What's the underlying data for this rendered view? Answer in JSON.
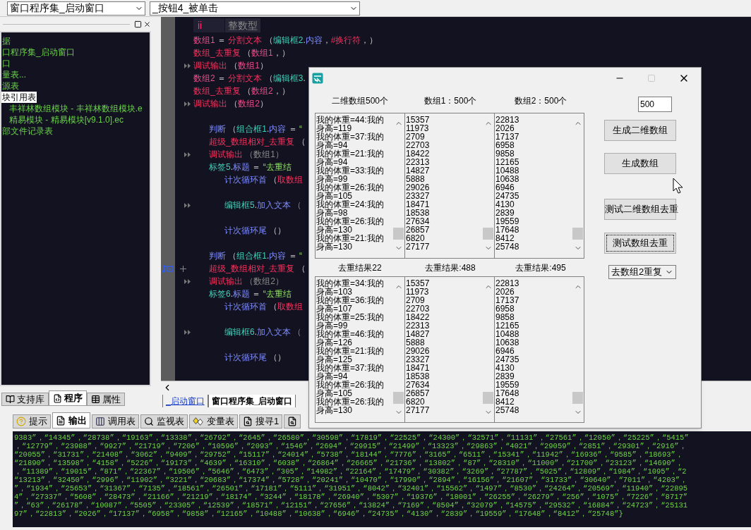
{
  "toolbar": {
    "combos": [
      {
        "value": "窗口程序集_启动窗口"
      },
      {
        "value": "_按钮4_被单击"
      }
    ]
  },
  "left_panel": {
    "tree": [
      {
        "label": "据",
        "selected": false
      },
      {
        "label": "口程序集_启动窗口",
        "selected": false
      },
      {
        "label": "口",
        "selected": false
      },
      {
        "label": "量表...",
        "selected": false
      },
      {
        "label": "源表",
        "selected": false
      },
      {
        "label": "块引用表",
        "selected": true,
        "children": [
          {
            "label": "丰祥林数组模块 - 丰祥林数组模块.e",
            "selected": false
          },
          {
            "label": "精易模块 - 精易模块[v9.1.0].ec",
            "selected": false
          }
        ]
      },
      {
        "label": "部文件记录表",
        "selected": false
      }
    ],
    "tabs": [
      {
        "label": "支持库",
        "selected": false
      },
      {
        "label": "程序",
        "selected": true
      },
      {
        "label": "属性",
        "selected": false
      }
    ]
  },
  "editor": {
    "variable_row": [
      "ii",
      "整数型"
    ],
    "lines": [
      {
        "kind": "code",
        "marked": false,
        "current": false,
        "tokens": [
          {
            "text": "数组1",
            "kind": "var"
          },
          {
            "text": " ＝ ",
            "kind": "op"
          },
          {
            "text": "分割文本",
            "kind": "func"
          },
          {
            "text": " （",
            "kind": "punct"
          },
          {
            "text": "编辑框2",
            "kind": "obj"
          },
          {
            "text": ".",
            "kind": "punct"
          },
          {
            "text": "内容",
            "kind": "ctrl"
          },
          {
            "text": "，",
            "kind": "punct"
          },
          {
            "text": "#换行符",
            "kind": "func"
          },
          {
            "text": "，）",
            "kind": "punct"
          }
        ]
      },
      {
        "kind": "code",
        "marked": false,
        "current": false,
        "tokens": [
          {
            "text": "数组_去重复",
            "kind": "func"
          },
          {
            "text": " （",
            "kind": "punct"
          },
          {
            "text": "数组1",
            "kind": "var"
          },
          {
            "text": "，）",
            "kind": "punct"
          }
        ]
      },
      {
        "kind": "code",
        "marked": true,
        "current": false,
        "tokens": [
          {
            "text": "调试输出",
            "kind": "func"
          },
          {
            "text": " （",
            "kind": "punct"
          },
          {
            "text": "数组1",
            "kind": "var"
          },
          {
            "text": "）",
            "kind": "punct"
          }
        ]
      },
      {
        "kind": "code",
        "marked": false,
        "current": false,
        "tokens": [
          {
            "text": "数组2",
            "kind": "var"
          },
          {
            "text": " ＝ ",
            "kind": "op"
          },
          {
            "text": "分割文本",
            "kind": "func"
          },
          {
            "text": " （",
            "kind": "punct"
          },
          {
            "text": "编辑框3",
            "kind": "obj"
          },
          {
            "text": ".",
            "kind": "punct"
          }
        ]
      },
      {
        "kind": "code",
        "marked": false,
        "current": false,
        "tokens": [
          {
            "text": "数组_去重复",
            "kind": "func"
          },
          {
            "text": " （",
            "kind": "punct"
          },
          {
            "text": "数组2",
            "kind": "var"
          },
          {
            "text": "，）",
            "kind": "punct"
          }
        ]
      },
      {
        "kind": "code",
        "marked": true,
        "current": false,
        "tokens": [
          {
            "text": "调试输出",
            "kind": "func"
          },
          {
            "text": " （",
            "kind": "punct"
          },
          {
            "text": "数组2",
            "kind": "var"
          },
          {
            "text": "）",
            "kind": "punct"
          }
        ]
      },
      {
        "kind": "blank"
      },
      {
        "kind": "code",
        "marked": false,
        "current": false,
        "tokens": [
          {
            "text": "判断",
            "kind": "ctrl"
          },
          {
            "text": " （",
            "kind": "punct"
          },
          {
            "text": "组合框1",
            "kind": "obj"
          },
          {
            "text": ".",
            "kind": "punct"
          },
          {
            "text": "内容",
            "kind": "ctrl"
          },
          {
            "text": " ＝ ",
            "kind": "op"
          },
          {
            "text": "“",
            "kind": "str"
          }
        ],
        "children": [
          {
            "kind": "code",
            "marked": false,
            "current": false,
            "tokens": [
              {
                "text": "超级_数组相对_去重复",
                "kind": "func"
              },
              {
                "text": " （",
                "kind": "punct"
              }
            ]
          },
          {
            "kind": "code",
            "marked": true,
            "current": false,
            "tokens": [
              {
                "text": "调试输出",
                "kind": "func"
              },
              {
                "text": " （数组1）",
                "kind": "dim"
              }
            ]
          },
          {
            "kind": "code",
            "marked": false,
            "current": false,
            "tokens": [
              {
                "text": "标签5",
                "kind": "obj"
              },
              {
                "text": ".",
                "kind": "punct"
              },
              {
                "text": "标题",
                "kind": "ctrl"
              },
              {
                "text": " ＝ ",
                "kind": "op"
              },
              {
                "text": "“去重结",
                "kind": "str"
              }
            ]
          },
          {
            "kind": "code",
            "marked": false,
            "current": false,
            "tokens": [
              {
                "text": "计次循环首",
                "kind": "ctrl"
              },
              {
                "text": " （",
                "kind": "punct"
              },
              {
                "text": "取数组",
                "kind": "func"
              }
            ],
            "children": [
              {
                "kind": "blank"
              },
              {
                "kind": "code",
                "marked": true,
                "current": false,
                "tokens": [
                  {
                    "text": "编辑框5",
                    "kind": "obj"
                  },
                  {
                    "text": ".",
                    "kind": "punct"
                  },
                  {
                    "text": "加入文本",
                    "kind": "ctrl"
                  },
                  {
                    "text": " （",
                    "kind": "dim"
                  }
                ]
              },
              {
                "kind": "blank"
              },
              {
                "kind": "code",
                "marked": false,
                "current": false,
                "tokens": [
                  {
                    "text": "计次循环尾",
                    "kind": "ctrl"
                  },
                  {
                    "text": " （）",
                    "kind": "punct"
                  }
                ]
              }
            ]
          },
          {
            "kind": "blank"
          }
        ]
      },
      {
        "kind": "code",
        "marked": false,
        "current": false,
        "tokens": [
          {
            "text": "判断",
            "kind": "ctrl"
          },
          {
            "text": " （",
            "kind": "punct"
          },
          {
            "text": "组合框1",
            "kind": "obj"
          },
          {
            "text": ".",
            "kind": "punct"
          },
          {
            "text": "内容",
            "kind": "ctrl"
          },
          {
            "text": " ＝ ",
            "kind": "op"
          },
          {
            "text": "“",
            "kind": "str"
          }
        ],
        "children": [
          {
            "kind": "code",
            "marked": false,
            "current": true,
            "tokens": [
              {
                "text": "超级_数组相对_去重复",
                "kind": "func"
              },
              {
                "text": " （",
                "kind": "punct"
              }
            ]
          },
          {
            "kind": "code",
            "marked": true,
            "current": false,
            "tokens": [
              {
                "text": "调试输出",
                "kind": "func"
              },
              {
                "text": " （数组2）",
                "kind": "dim"
              }
            ]
          },
          {
            "kind": "code",
            "marked": false,
            "current": false,
            "tokens": [
              {
                "text": "标签6",
                "kind": "obj"
              },
              {
                "text": ".",
                "kind": "punct"
              },
              {
                "text": "标题",
                "kind": "ctrl"
              },
              {
                "text": " ＝ ",
                "kind": "op"
              },
              {
                "text": "“去重结",
                "kind": "str"
              }
            ]
          },
          {
            "kind": "code",
            "marked": false,
            "current": false,
            "tokens": [
              {
                "text": "计次循环首",
                "kind": "ctrl"
              },
              {
                "text": " （",
                "kind": "punct"
              },
              {
                "text": "取数组",
                "kind": "func"
              }
            ],
            "children": [
              {
                "kind": "blank"
              },
              {
                "kind": "code",
                "marked": true,
                "current": false,
                "tokens": [
                  {
                    "text": "编辑框6",
                    "kind": "obj"
                  },
                  {
                    "text": ".",
                    "kind": "punct"
                  },
                  {
                    "text": "加入文本",
                    "kind": "ctrl"
                  },
                  {
                    "text": " （",
                    "kind": "dim"
                  }
                ]
              },
              {
                "kind": "blank"
              },
              {
                "kind": "code",
                "marked": false,
                "current": false,
                "tokens": [
                  {
                    "text": "计次循环尾",
                    "kind": "ctrl"
                  },
                  {
                    "text": " （）",
                    "kind": "punct"
                  }
                ]
              }
            ]
          }
        ]
      }
    ],
    "tabs": [
      {
        "label": "_启动窗口",
        "selected": false
      },
      {
        "label": "窗口程序集_启动窗口",
        "selected": true
      }
    ]
  },
  "dialog": {
    "maximize_disabled": true,
    "top_labels": [
      "二维数组500个",
      "数组1：500个",
      "数组2：500个"
    ],
    "top_lists": [
      [
        "我的体重=44:我的身高=119",
        "我的体重=37:我的身高=94",
        "我的体重=21:我的身高=94",
        "我的体重=33:我的身高=99",
        "我的体重=26:我的身高=105",
        "我的体重=24:我的身高=98",
        "我的体重=26:我的身高=130",
        "我的体重=21:我的身高=130"
      ],
      [
        "15357",
        "11973",
        "2709",
        "22703",
        "18422",
        "22313",
        "14827",
        "5888",
        "29026",
        "23327",
        "18471",
        "18538",
        "27634",
        "26857",
        "6820",
        "27177"
      ],
      [
        "22813",
        "2026",
        "17137",
        "6958",
        "9858",
        "12165",
        "10488",
        "10638",
        "6946",
        "24735",
        "4130",
        "2839",
        "19559",
        "17648",
        "8412",
        "25748"
      ]
    ],
    "bottom_labels": [
      "去重结果22",
      "去重结果:488",
      "去重结果:495"
    ],
    "bottom_lists": [
      [
        "我的体重=34:我的身高=103",
        "我的体重=36:我的身高=107",
        "我的体重=25:我的身高=99",
        "我的体重=46:我的身高=126",
        "我的体重=21:我的身高=125",
        "我的体重=37:我的身高=94",
        "我的体重=26:我的身高=105",
        "我的体重=26:我的身高=130"
      ],
      [
        "15357",
        "11973",
        "2709",
        "22703",
        "18422",
        "22313",
        "14827",
        "5888",
        "29026",
        "23327",
        "18471",
        "18538",
        "27634",
        "26857",
        "6820",
        "27177"
      ],
      [
        "22813",
        "2026",
        "17137",
        "6958",
        "9858",
        "12165",
        "10488",
        "10638",
        "6946",
        "24735",
        "4130",
        "2839",
        "19559",
        "17648",
        "8412",
        "25748"
      ]
    ],
    "count_field": {
      "value": "500"
    },
    "buttons": [
      {
        "label": "生成二维数组",
        "focused": false
      },
      {
        "label": "生成数组",
        "focused": false
      },
      {
        "label": "测试二维数组去重",
        "focused": false
      },
      {
        "label": "测试数组去重",
        "focused": true
      }
    ],
    "mode_select": {
      "value": "去数组2重复"
    }
  },
  "output_panel": {
    "tabs": [
      {
        "label": "提示",
        "selected": false
      },
      {
        "label": "输出",
        "selected": true
      },
      {
        "label": "调用表",
        "selected": false
      },
      {
        "label": "监视表",
        "selected": false
      },
      {
        "label": "变量表",
        "selected": false
      },
      {
        "label": "搜寻1",
        "selected": false
      },
      {
        "selected": false
      }
    ],
    "lines": [
      "9383”，“14345”，“28738”，“19163”，“13338”，“26792”，“2645”，“26580”，“30598”，“17819”，“22525”，“24300”，“32571”，“11131”，“27561”，“12050”，“25225”，“5415”",
      "，“12779”，“23988”，“9927”，“21719”，“7206”，“10596”，“2093”，“1546”，“2694”，“29915”，“21499”，“13323”，“29863”，“4021”，“29059”，“2851”，“29301”，“2916”，",
      "“20055”，“31731”，“21408”，“3062”，“9409”，“29752”，“15117”，“24014”，“5738”，“18144”，“7776”，“3165”，“6511”，“15341”，“11942”，“16936”，“9585”，“18693”，",
      "“21890”，“13598”，“4158”，“5226”，“19173”，“4639”，“16310”，“6038”，“26864”，“26665”，“21736”，“13802”，“87”，“28310”，“11000”，“21700”，“23123”，“14690”，",
      "，“11389”，“19015”，“871”，“22367”，“19506”，“5646”，“6473”，“305”，“14982”，“22164”，“17479”，“30382”，“3269”，“27787”，“5025”，“12809”，“1984”，“1095”，“2",
      "“13213”，“32450”，“2996”，“11902”，“3221”，“20683”，“17374”，“5728”，“20241”，“10470”，“17990”，“2894”，“16156”，“21607”，“31733”，“30640”，“7011”，“4203”，",
      "”，“1934”，“25653”，“31367”，“7135”，“18561”，“26501”，“17181”，“5111”，“31951”，“8042”，“32401”，“15562”，“1497”，“8530”，“24264”，“20569”，“11940”，“22895",
      "4”，“27337”，“5608”，“28473”，“21166”，“21219”，“18174”，“3244”，“18178”，“26940”，“5307”，“19376”，“18001”，“26255”，“26279”，“256”，“1075”，“7226”，“8717”",
      "”，“63”，“26178”，“10087”，“5505”，“23305”，“12539”，“18571”，“12151”，“27656”，“13824”，“7169”，“8504”，“32079”，“14575”，“29532”，“16884”，“24723”，“25131",
      "97”，“22813”，“2026”，“17137”，“6958”，“9858”，“12165”，“10488”，“10638”，“6946”，“24735”，“4130”，“2839”，“19559”，“17648”，“8412”，“25748”}"
    ]
  }
}
